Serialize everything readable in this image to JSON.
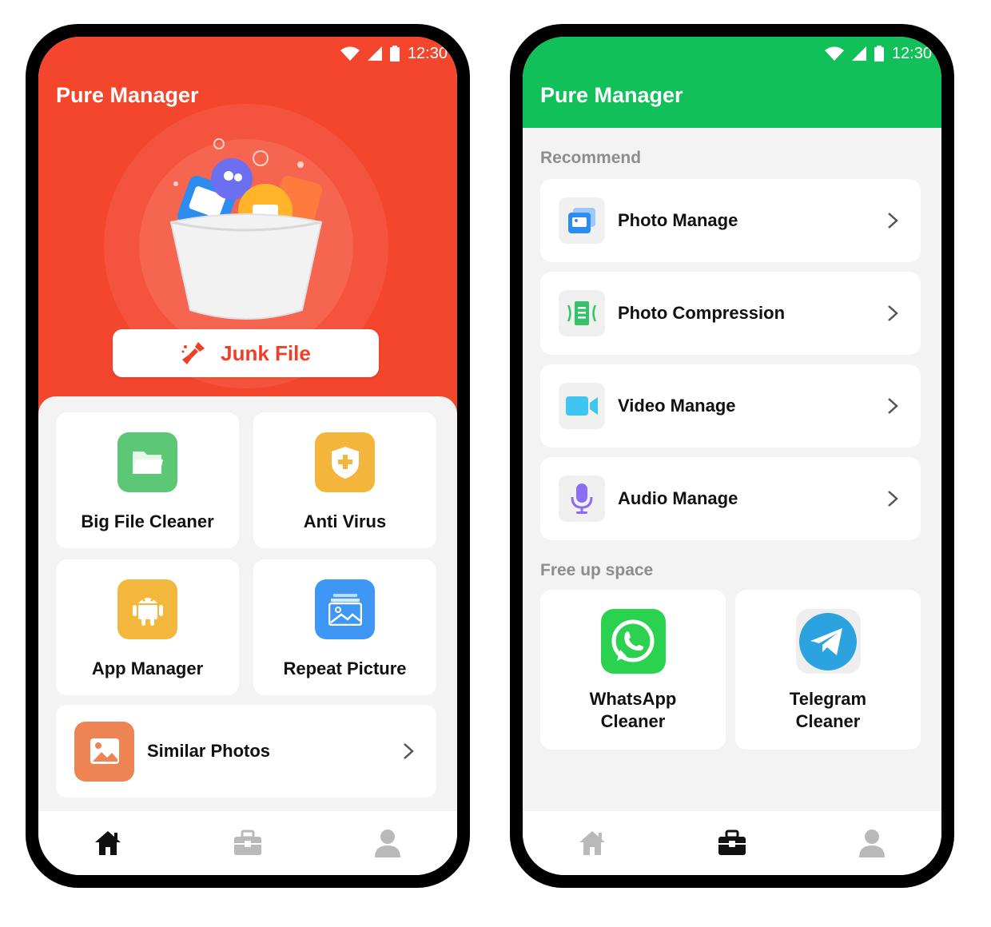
{
  "status": {
    "time": "12:30"
  },
  "home": {
    "title": "Pure Manager",
    "junk_button": "Junk File",
    "tiles": [
      {
        "label": "Big File Cleaner",
        "icon": "folder-icon",
        "color": "#5cc774"
      },
      {
        "label": "Anti Virus",
        "icon": "shield-plus-icon",
        "color": "#f3b53c"
      },
      {
        "label": "App Manager",
        "icon": "android-icon",
        "color": "#f4b73e"
      },
      {
        "label": "Repeat Picture",
        "icon": "pictures-icon",
        "color": "#3f97f5"
      }
    ],
    "wide_tile": {
      "label": "Similar Photos",
      "icon": "photo-icon",
      "color": "#ee8453"
    }
  },
  "tools": {
    "title": "Pure Manager",
    "recommend_label": "Recommend",
    "recommend": [
      {
        "label": "Photo Manage",
        "icon": "photo-manage-icon"
      },
      {
        "label": "Photo Compression",
        "icon": "compression-icon"
      },
      {
        "label": "Video Manage",
        "icon": "video-camera-icon"
      },
      {
        "label": "Audio Manage",
        "icon": "microphone-icon"
      }
    ],
    "free_label": "Free up space",
    "apps": [
      {
        "label": "WhatsApp Cleaner",
        "icon": "whatsapp-icon"
      },
      {
        "label": "Telegram Cleaner",
        "icon": "telegram-icon"
      }
    ]
  },
  "colors": {
    "red": "#f3462d",
    "green": "#12c05a",
    "nav_active": "#111111",
    "nav_inactive": "#b9b9b9"
  }
}
